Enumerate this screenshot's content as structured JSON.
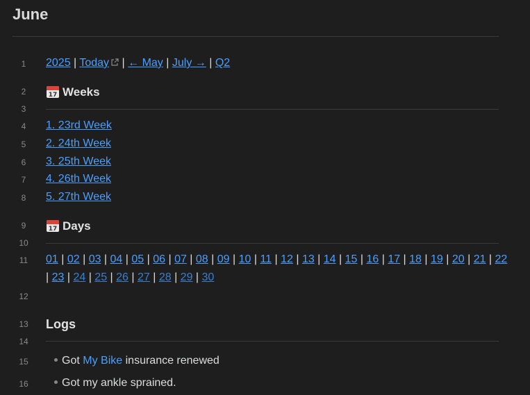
{
  "page": {
    "title": "June"
  },
  "line_numbers": [
    "1",
    "2",
    "3",
    "4",
    "5",
    "6",
    "7",
    "8",
    "9",
    "10",
    "11",
    "12",
    "13",
    "14",
    "15",
    "16"
  ],
  "nav": {
    "year": "2025",
    "sep": "|",
    "today": "Today",
    "prev": "← May",
    "next": "July →",
    "quarter": "Q2"
  },
  "weeks": {
    "heading": "Weeks",
    "items": [
      "1. 23rd Week",
      "2. 24th Week",
      "3. 25th Week",
      "4. 26th Week",
      "5. 27th Week"
    ]
  },
  "days": {
    "heading": "Days",
    "row1": [
      "01",
      "02",
      "03",
      "04",
      "05",
      "06",
      "07",
      "08",
      "09",
      "10",
      "11",
      "12",
      "13",
      "14",
      "15",
      "16",
      "17",
      "18",
      "19",
      "20",
      "21",
      "22"
    ],
    "row2": [
      "23",
      "24",
      "25",
      "26",
      "27",
      "28",
      "29",
      "30"
    ]
  },
  "logs": {
    "heading": "Logs",
    "item1_prefix": "Got",
    "item1_link": "My Bike",
    "item1_suffix": "insurance renewed",
    "item2": "Got my ankle sprained."
  },
  "icons": {
    "calendar": "calendar-icon",
    "external": "external-link-icon"
  },
  "colors": {
    "link": "#4a9fff",
    "background": "#1e1e1e"
  }
}
